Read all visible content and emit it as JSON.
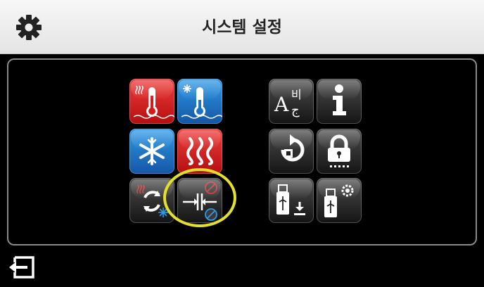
{
  "header": {
    "title": "시스템 설정",
    "settings_icon": "gear-icon"
  },
  "tiles": {
    "heating_temperature": {
      "icon": "heating-thermometer-icon",
      "color": "#d21d1d"
    },
    "cooling_temperature": {
      "icon": "cooling-thermometer-icon",
      "color": "#1e73c8"
    },
    "cooling_mode": {
      "icon": "snowflake-icon",
      "color": "#1e73c8"
    },
    "heating_mode": {
      "icon": "heat-waves-icon",
      "color": "#d21d1d"
    },
    "auto_changeover": {
      "icon": "heat-cool-changeover-icon",
      "color": "#2a2a2a"
    },
    "deadband": {
      "icon": "deadband-icon",
      "color": "#2a2a2a",
      "selected": true
    },
    "language": {
      "icon": "language-icon",
      "glyphs": [
        "A",
        "비",
        "ج"
      ]
    },
    "information": {
      "icon": "info-icon",
      "glyph": "i"
    },
    "restart": {
      "icon": "restart-icon"
    },
    "lock": {
      "icon": "lock-icon"
    },
    "usb_import": {
      "icon": "usb-download-icon"
    },
    "usb_settings": {
      "icon": "usb-settings-icon"
    }
  },
  "highlight_color": "#e2e02a",
  "footer": {
    "exit_icon": "exit-icon"
  }
}
